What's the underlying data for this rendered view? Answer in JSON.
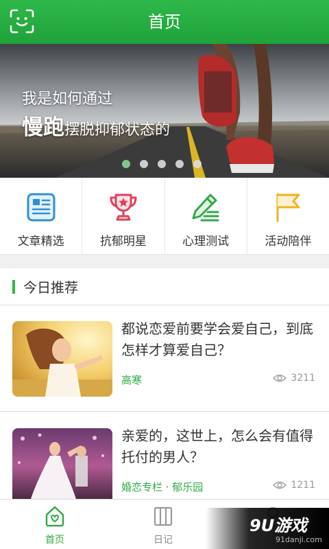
{
  "header": {
    "title": "首页",
    "face_icon": "face-scan-icon"
  },
  "banner": {
    "line1": "我是如何通过",
    "line2_big": "慢跑",
    "line2_small": "摆脱抑郁状态的",
    "slide_count": 5,
    "active_slide": 1
  },
  "quick_links": [
    {
      "label": "文章精选",
      "icon": "newspaper-icon",
      "color": "#2f8fd6"
    },
    {
      "label": "抗郁明星",
      "icon": "trophy-icon",
      "color": "#e0405a"
    },
    {
      "label": "心理测试",
      "icon": "pencil-icon",
      "color": "#2fa945"
    },
    {
      "label": "活动陪伴",
      "icon": "flag-icon",
      "color": "#f0b21e"
    }
  ],
  "recommend": {
    "heading": "今日推荐",
    "articles": [
      {
        "title": "都说恋爱前要学会爱自己，到底怎样才算爱自己？",
        "source": "高寒",
        "views": "3211"
      },
      {
        "title": "亲爱的，这世上，怎么会有值得托付的男人？",
        "source": "婚恋专栏 · 郁乐园",
        "views": "1211"
      }
    ]
  },
  "tabs": {
    "home": "首页",
    "diary": "日记"
  },
  "watermark": {
    "brand": "9U游戏",
    "domain": "91danji.com"
  },
  "colors": {
    "primary": "#2fa945"
  }
}
